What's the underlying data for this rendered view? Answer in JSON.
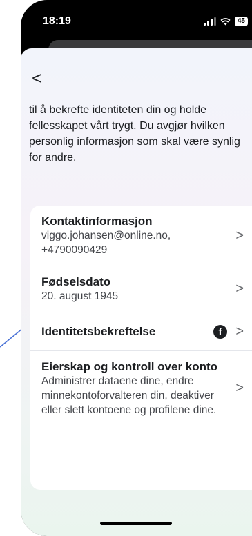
{
  "status_bar": {
    "time": "18:19",
    "battery": "45"
  },
  "nav": {
    "back_label": "<"
  },
  "intro_text": "til å bekrefte identiteten din og holde fellesskapet vårt trygt. Du avgjør hvilken personlig informasjon som skal være synlig for andre.",
  "items": [
    {
      "title": "Kontaktinformasjon",
      "subtitle": "viggo.johansen@online.no, +4790090429"
    },
    {
      "title": "Fødselsdato",
      "subtitle": "20. august 1945"
    },
    {
      "title": "Identitetsbekreftelse",
      "icon": "facebook-icon"
    },
    {
      "title": "Eierskap og kontroll over konto",
      "subtitle": "Administrer dataene dine, endre minnekontoforvalteren din, deaktiver eller slett kontoene og profilene dine."
    }
  ],
  "chevron": ">",
  "annotation_color": "#4a72d6"
}
